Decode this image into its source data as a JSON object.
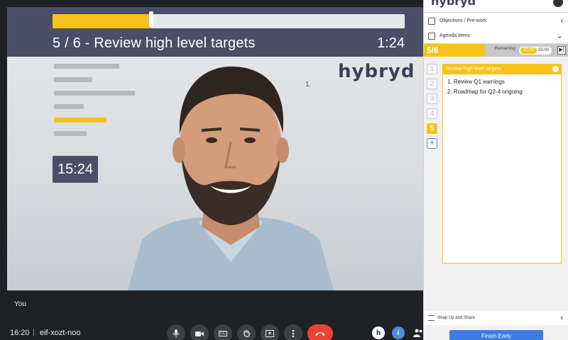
{
  "stage": {
    "progress": 0.28,
    "agenda_title": "5 / 6 - Review high level targets",
    "item_time": "1:24",
    "meeting_clock": "15:24",
    "logo_text": "hybryd",
    "small_marker": "1."
  },
  "call": {
    "you_label": "You",
    "time": "16:20",
    "separator": "|",
    "meeting_code": "eif-xozt-noo",
    "controls": [
      "mic-icon",
      "camera-icon",
      "captions-icon",
      "raise-hand-icon",
      "present-icon",
      "more-icon",
      "end-call-icon"
    ],
    "captions_text": "CC",
    "right_controls": [
      "h",
      "i"
    ]
  },
  "panel": {
    "logo_text": "hybryd",
    "objectives_label": "Objectives / Pre-work",
    "agenda_label": "Agenda Items",
    "current_step": "5/6",
    "remaining_label": "Remaining",
    "remaining_current": "15:00",
    "remaining_total": "25:00",
    "steps": [
      "1",
      "2",
      "3",
      "4",
      "5"
    ],
    "add_step": "+",
    "card_title": "Review high level targets",
    "card_items": [
      "1. Review Q1 earnings",
      "2. Roadmap for Q2-4 ongoing"
    ],
    "wrap_label": "Wrap Up and Share",
    "finish_label": "Finish Early"
  },
  "colors": {
    "accent": "#f7c31a",
    "overlay": "#4a4e66",
    "end_call": "#ea4335",
    "primary_button": "#3d7be5"
  }
}
